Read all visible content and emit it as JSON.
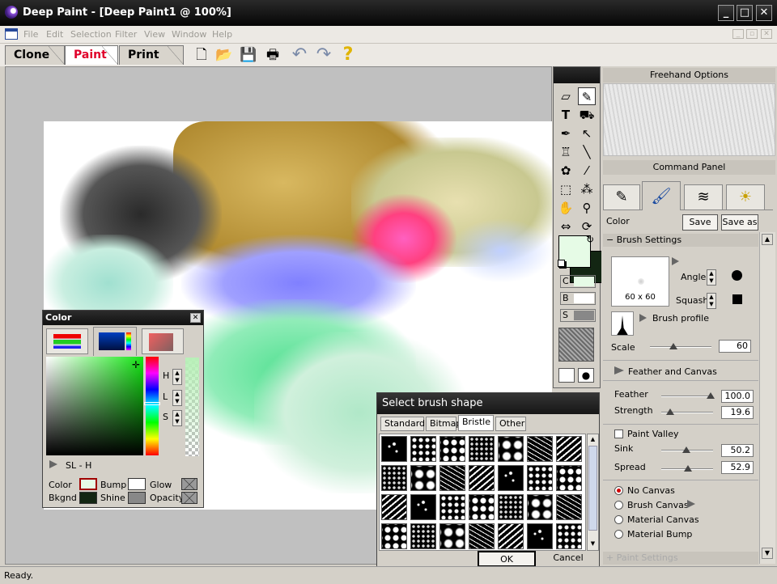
{
  "window": {
    "title": "Deep Paint - [Deep Paint1 @ 100%]",
    "min": "_",
    "max": "□",
    "close": "✕"
  },
  "menu": {
    "items": [
      "File",
      "Edit",
      "Selection",
      "Filter",
      "View",
      "Window",
      "Help"
    ],
    "mdi": [
      "_",
      "▫",
      "✕"
    ]
  },
  "mode_tabs": [
    "Clone",
    "Paint",
    "Print"
  ],
  "toolbar_icons": [
    "new-icon",
    "open-icon",
    "save-icon",
    "print-icon",
    "undo-icon",
    "redo-icon",
    "help-icon"
  ],
  "toolbar_glyphs": [
    "🗋",
    "📂",
    "💾",
    "🖶",
    "↶",
    "↷",
    "?"
  ],
  "toolbox": {
    "tools": [
      "eraser",
      "brush",
      "text",
      "fill",
      "pen",
      "select-arrow",
      "stamp",
      "line",
      "clone",
      "eyedropper",
      "marquee",
      "magic-wand",
      "hand",
      "zoom",
      "move",
      "rotate"
    ],
    "glyphs": [
      "▱",
      "✎",
      "T",
      "⛟",
      "✒",
      "↖",
      "♖",
      "╲",
      "✿",
      "⁄",
      "⬚",
      "⁂",
      "✋",
      "⚲",
      "⇔",
      "⟳"
    ],
    "swatch_rows": [
      {
        "letter": "C"
      },
      {
        "letter": "B"
      },
      {
        "letter": "S"
      }
    ],
    "swap": "↻"
  },
  "right_panel": {
    "freehand_title": "Freehand Options",
    "command_title": "Command Panel",
    "color_label": "Color",
    "save": "Save",
    "save_as": "Save as",
    "brush_settings": "Brush Settings",
    "brush_size": "60 x 60",
    "angle": "Angle",
    "squash": "Squash",
    "brush_profile": "Brush profile",
    "scale": "Scale",
    "scale_value": "60",
    "feather_and_canvas": "Feather and Canvas",
    "feather": "Feather",
    "feather_value": "100.0",
    "strength": "Strength",
    "strength_value": "19.6",
    "paint_valley": "Paint Valley",
    "sink": "Sink",
    "sink_value": "50.2",
    "spread": "Spread",
    "spread_value": "52.9",
    "canvas_options": [
      "No Canvas",
      "Brush Canvas",
      "Material Canvas",
      "Material Bump"
    ],
    "selected_canvas": "No Canvas",
    "paint_settings": "Paint Settings"
  },
  "color_window": {
    "title": "Color",
    "close": "✕",
    "h": "H",
    "l": "L",
    "s": "S",
    "mode": "SL - H",
    "labels": [
      "Color",
      "Bkgnd",
      "Bump",
      "Shine",
      "Glow",
      "Opacity"
    ]
  },
  "brush_window": {
    "title": "Select brush shape",
    "tabs": [
      "Standard",
      "Bitmap",
      "Bristle",
      "Other"
    ],
    "active_tab": "Bristle",
    "ok": "OK",
    "cancel": "Cancel"
  },
  "status": "Ready."
}
